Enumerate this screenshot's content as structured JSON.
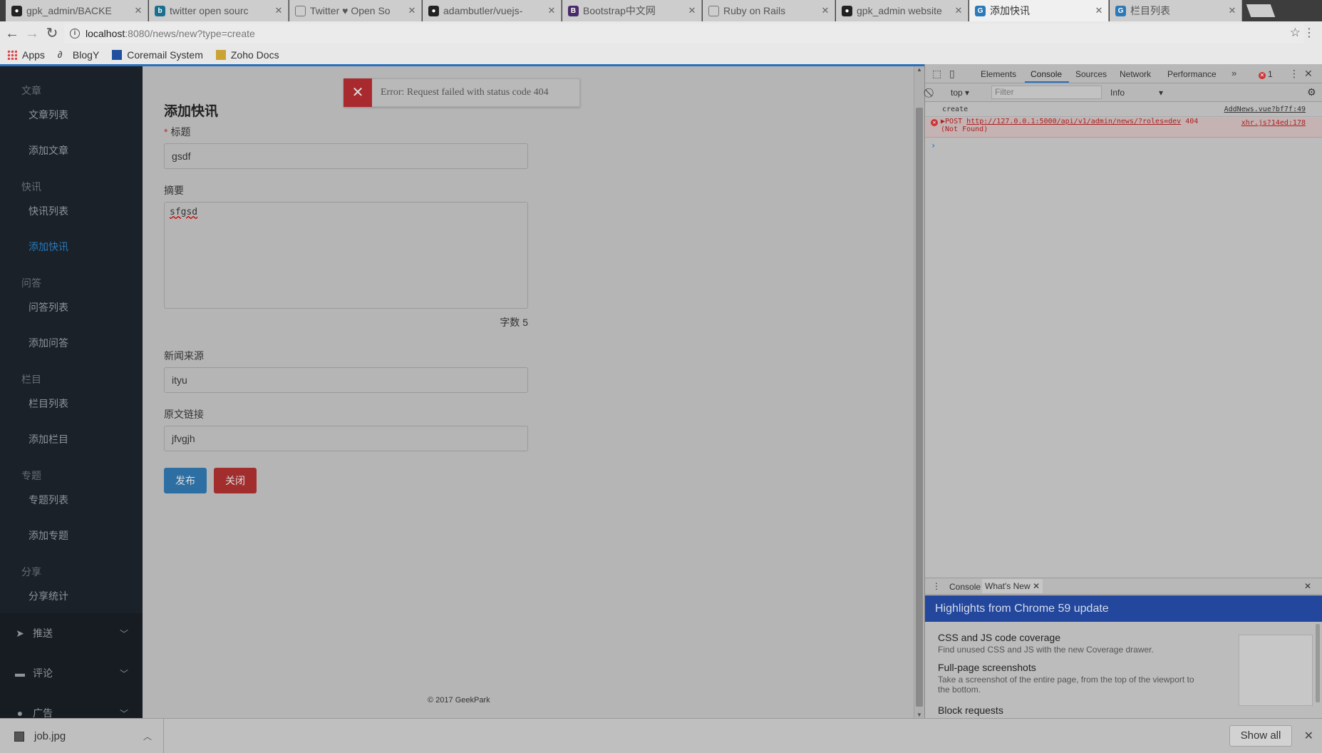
{
  "browser": {
    "tabs": [
      {
        "title": "gpk_admin/BACKE",
        "favicon": "github-icon",
        "active": false
      },
      {
        "title": "twitter open sourc",
        "favicon": "b-icon",
        "active": false
      },
      {
        "title": "Twitter ♥ Open So",
        "favicon": "page-icon",
        "active": false
      },
      {
        "title": "adambutler/vuejs-",
        "favicon": "github-icon",
        "active": false
      },
      {
        "title": "Bootstrap中文网",
        "favicon": "bootstrap-icon",
        "active": false
      },
      {
        "title": "Ruby on Rails",
        "favicon": "page-icon",
        "active": false
      },
      {
        "title": "gpk_admin website",
        "favicon": "github-icon",
        "active": false
      },
      {
        "title": "添加快讯",
        "favicon": "g-icon",
        "active": true
      },
      {
        "title": "栏目列表",
        "favicon": "g-icon",
        "active": false
      }
    ],
    "url_host": "localhost",
    "url_path": ":8080/news/new?type=create",
    "bookmarks": [
      {
        "label": "Apps",
        "icon": "apps-grid-icon"
      },
      {
        "label": "BlogY",
        "icon": "blogy-icon"
      },
      {
        "label": "Coremail System",
        "icon": "mail-icon"
      },
      {
        "label": "Zoho Docs",
        "icon": "folder-icon"
      }
    ]
  },
  "sidebar": {
    "groups": [
      {
        "title": "文章",
        "items": [
          {
            "label": "文章列表",
            "active": false
          },
          {
            "label": "添加文章",
            "active": false
          }
        ]
      },
      {
        "title": "快讯",
        "items": [
          {
            "label": "快讯列表",
            "active": false
          },
          {
            "label": "添加快讯",
            "active": true
          }
        ]
      },
      {
        "title": "问答",
        "items": [
          {
            "label": "问答列表",
            "active": false
          },
          {
            "label": "添加问答",
            "active": false
          }
        ]
      },
      {
        "title": "栏目",
        "items": [
          {
            "label": "栏目列表",
            "active": false
          },
          {
            "label": "添加栏目",
            "active": false
          }
        ]
      },
      {
        "title": "专题",
        "items": [
          {
            "label": "专题列表",
            "active": false
          },
          {
            "label": "添加专题",
            "active": false
          }
        ]
      },
      {
        "title": "分享",
        "items": [
          {
            "label": "分享统计",
            "active": false
          }
        ]
      }
    ],
    "collapsibles": [
      {
        "label": "推送",
        "icon": "paper-plane-icon"
      },
      {
        "label": "评论",
        "icon": "comment-icon"
      },
      {
        "label": "广告",
        "icon": "ad-icon"
      }
    ]
  },
  "form": {
    "title": "添加快讯",
    "title_label": "标题",
    "title_value": "gsdf",
    "summary_label": "摘要",
    "summary_value": "sfgsd",
    "word_count": "字数 5",
    "source_label": "新闻来源",
    "source_value": "ityu",
    "link_label": "原文链接",
    "link_value": "jfvgjh",
    "publish_label": "发布",
    "close_label": "关闭"
  },
  "toast": {
    "message": "Error: Request failed with status code 404"
  },
  "footer": "© 2017 GeekPark",
  "devtools": {
    "tabs": [
      "Elements",
      "Console",
      "Sources",
      "Network",
      "Performance"
    ],
    "active_tab": "Console",
    "error_count": "1",
    "context": "top",
    "filter_placeholder": "Filter",
    "level": "Info",
    "log": {
      "text": "create",
      "source": "AddNews.vue?bf7f:49"
    },
    "error": {
      "method": "POST",
      "url": "http://127.0.0.1:5000/api/v1/admin/news/?roles=dev",
      "status": "404",
      "status_text": "(Not Found)",
      "source": "xhr.js?14ed:178"
    },
    "drawer_tabs": [
      "Console",
      "What's New"
    ],
    "highlights_title": "Highlights from Chrome 59 update",
    "whats_new": [
      {
        "title": "CSS and JS code coverage",
        "desc": "Find unused CSS and JS with the new Coverage drawer."
      },
      {
        "title": "Full-page screenshots",
        "desc": "Take a screenshot of the entire page, from the top of the viewport to the bottom."
      },
      {
        "title": "Block requests",
        "desc": ""
      }
    ]
  },
  "downloads": {
    "file": "job.jpg",
    "show_all": "Show all"
  }
}
